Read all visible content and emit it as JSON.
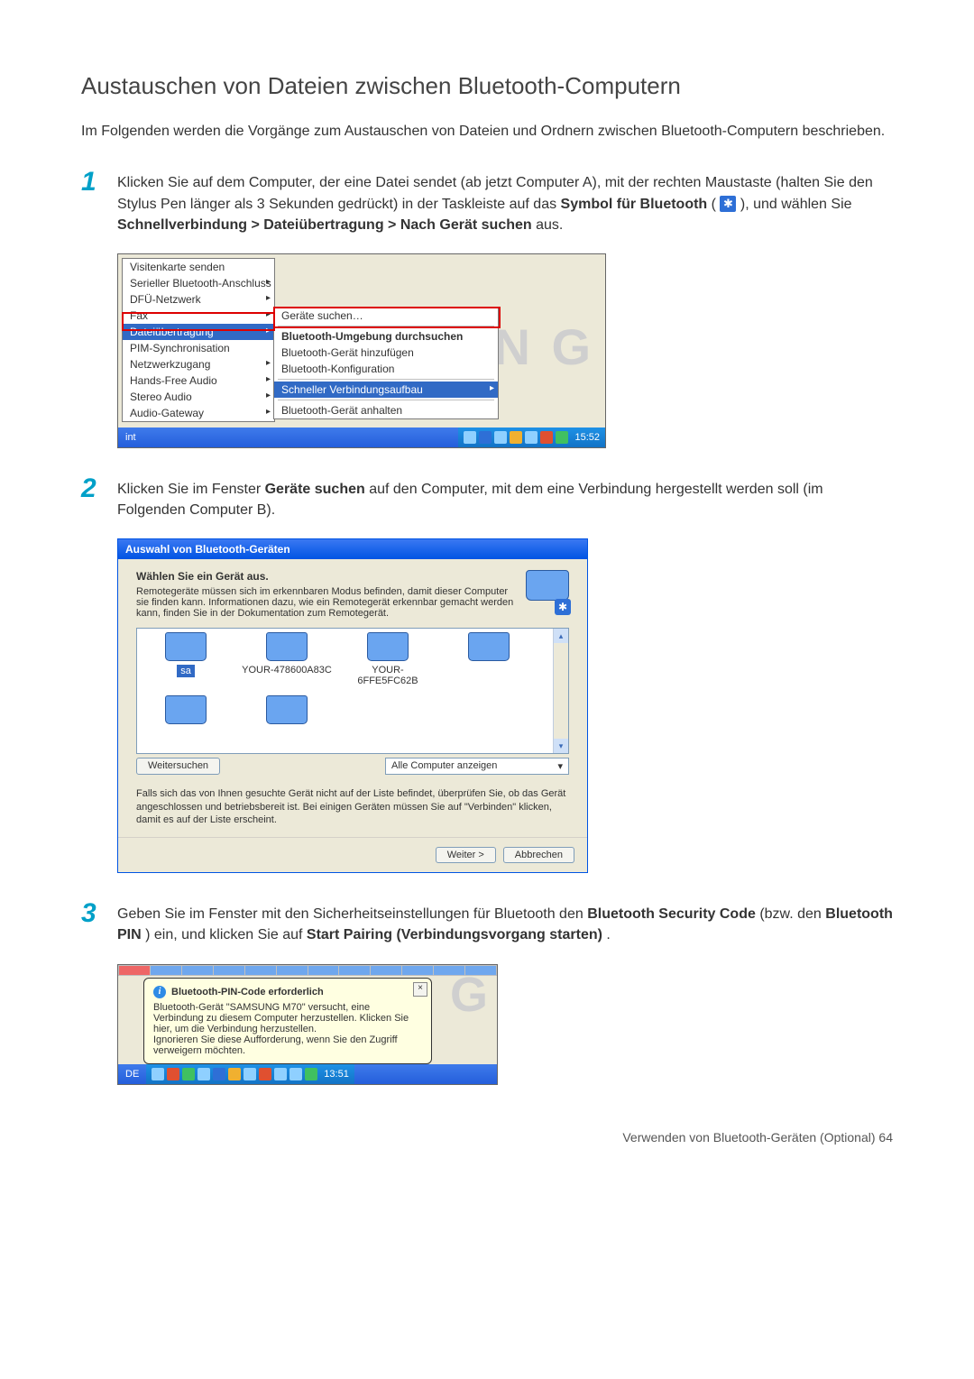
{
  "section_title": "Austauschen von Dateien zwischen Bluetooth-Computern",
  "intro": "Im Folgenden werden die Vorgänge zum Austauschen von Dateien und Ordnern zwischen Bluetooth-Computern beschrieben.",
  "steps": {
    "s1": {
      "num": "1",
      "text_a": "Klicken Sie auf dem Computer, der eine Datei sendet (ab jetzt Computer A), mit der rechten Maustaste (halten Sie den Stylus Pen länger als 3 Sekunden gedrückt) in der Taskleiste auf das ",
      "text_b": "Symbol für Bluetooth",
      "text_c": " ( ",
      "text_d": " ), und wählen Sie ",
      "text_e": "Schnellverbindung > Dateiübertragung > Nach Gerät suchen",
      "text_f": " aus."
    },
    "s2": {
      "num": "2",
      "text_a": "Klicken Sie im Fenster ",
      "text_b": "Geräte suchen",
      "text_c": " auf den Computer, mit dem eine Verbindung hergestellt werden soll (im Folgenden Computer B)."
    },
    "s3": {
      "num": "3",
      "text_a": "Geben Sie im Fenster mit den Sicherheitseinstellungen für Bluetooth den ",
      "text_b": "Bluetooth Security Code",
      "text_c": " (bzw. den ",
      "text_d": "Bluetooth PIN",
      "text_e": ") ein, und klicken Sie auf ",
      "text_f": "Start Pairing (Verbindungsvorgang starten)",
      "text_g": "."
    }
  },
  "shot1": {
    "menu1": {
      "i0": "Visitenkarte senden",
      "i1": "Serieller Bluetooth-Anschluss",
      "i2": "DFÜ-Netzwerk",
      "i3": "Fax",
      "i4": "Dateiübertragung",
      "i5": "PIM-Synchronisation",
      "i6": "Netzwerkzugang",
      "i7": "Hands-Free Audio",
      "i8": "Stereo Audio",
      "i9": "Audio-Gateway"
    },
    "menu2": {
      "i0": "Geräte suchen…",
      "i1": "Bluetooth-Umgebung durchsuchen",
      "i2": "Bluetooth-Gerät hinzufügen",
      "i3": "Bluetooth-Konfiguration",
      "i4": "Schneller Verbindungsaufbau",
      "i5": "Bluetooth-Gerät anhalten"
    },
    "taskbar_left": "int",
    "clock": "15:52",
    "bg_text": "N G"
  },
  "shot2": {
    "title": "Auswahl von Bluetooth-Geräten",
    "subhead": "Wählen Sie ein Gerät aus.",
    "desc": "Remotegeräte müssen sich im erkennbaren Modus befinden, damit dieser Computer sie finden kann. Informationen dazu, wie ein Remotegerät erkennbar gemacht werden kann, finden Sie in der Dokumentation zum Remotegerät.",
    "devices": {
      "d0": "sa",
      "d1": "YOUR-478600A83C",
      "d2": "YOUR-6FFE5FC62B"
    },
    "btn_search": "Weitersuchen",
    "select_label": "Alle Computer anzeigen",
    "note": "Falls sich das von Ihnen gesuchte Gerät nicht auf der Liste befindet, überprüfen Sie, ob das Gerät angeschlossen und betriebsbereit ist. Bei einigen Geräten müssen Sie auf \"Verbinden\" klicken, damit es auf der Liste erscheint.",
    "btn_next": "Weiter >",
    "btn_cancel": "Abbrechen"
  },
  "shot3": {
    "balloon_title": "Bluetooth-PIN-Code erforderlich",
    "balloon_body": "Bluetooth-Gerät \"SAMSUNG M70\" versucht, eine Verbindung zu diesem Computer herzustellen. Klicken Sie hier, um die Verbindung herzustellen.\nIgnorieren Sie diese Aufforderung, wenn Sie den Zugriff verweigern möchten.",
    "lang": "DE",
    "clock": "13:51",
    "deco": "G"
  },
  "footer": "Verwenden von Bluetooth-Geräten (Optional)    64"
}
